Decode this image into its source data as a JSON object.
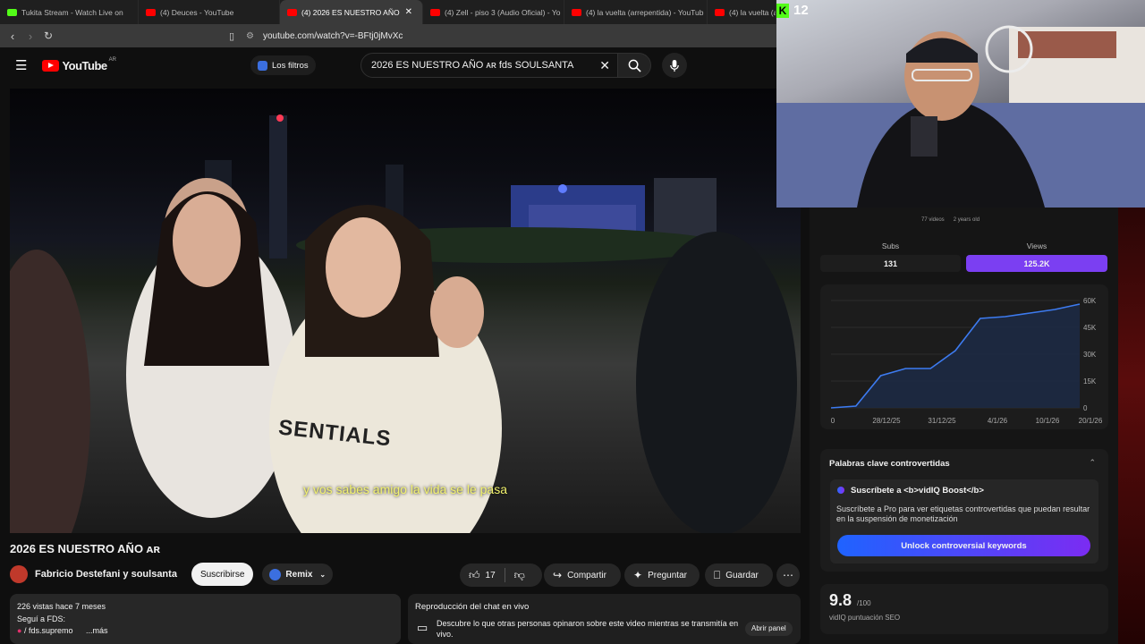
{
  "browser": {
    "tabs": [
      {
        "title": "Tukita Stream - Watch Live on",
        "color": "#53fc18"
      },
      {
        "title": "(4) Deuces - YouTube",
        "color": "#ff0000"
      },
      {
        "title": "(4) 2026 ES NUESTRO AÑO",
        "color": "#ff0000",
        "active": true
      },
      {
        "title": "(4) Zell - piso 3 (Audio Oficial) - Yo",
        "color": "#ff0000"
      },
      {
        "title": "(4) la vuelta (arrepentida) - YouTub",
        "color": "#ff0000"
      },
      {
        "title": "(4) la vuelta (a",
        "color": "#ff0000"
      }
    ],
    "url": "youtube.com/watch?v=-BFtj0jMvXc"
  },
  "youtube": {
    "logo": "YouTube",
    "region": "AR",
    "filters_label": "Los filtros",
    "search_value": "2026 ES NUESTRO AÑO ᴀʀ fds SOULSANTA"
  },
  "video": {
    "caption": "y vos sabes amigo la vida se le pasa",
    "shirt_text": "SENTIALS",
    "title": "2026 ES NUESTRO AÑO ᴀʀ",
    "channel": "Fabricio Destefani y soulsanta",
    "subscribe_label": "Suscribirse",
    "remix_label": "Remix",
    "likes": "17",
    "share_label": "Compartir",
    "ask_label": "Preguntar",
    "save_label": "Guardar"
  },
  "description": {
    "meta": "226 vistas  hace 7 meses",
    "line1": "Seguí a FDS:",
    "handle": "/ fds.supremo",
    "more": "...más"
  },
  "chat_panel": {
    "title": "Reproducción del chat en vivo",
    "text": "Descubre lo que otras personas opinaron sobre este video mientras se transmitía en vivo.",
    "button": "Abrir panel"
  },
  "stream_overlay": {
    "viewers": "12"
  },
  "vidiq": {
    "top_stats": [
      "77 videos",
      "2 years old"
    ],
    "subs_label": "Subs",
    "subs_value": "131",
    "views_label": "Views",
    "views_value": "125.2K",
    "keywords_title": "Palabras clave controvertidas",
    "boost_title": "Suscríbete a <b>vidIQ Boost</b>",
    "boost_text": "Suscríbete a Pro para ver etiquetas controvertidas que puedan resultar en la suspensión de monetización",
    "unlock_label": "Unlock controversial keywords",
    "seo_score": "9.8",
    "seo_max": "/100",
    "seo_label": "vidIQ puntuación SEO"
  },
  "chart_data": {
    "type": "area",
    "x_ticks": [
      "0",
      "28/12/25",
      "31/12/25",
      "4/1/26",
      "10/1/26",
      "20/1/26"
    ],
    "y_ticks": [
      "60K",
      "45K",
      "30K",
      "15K",
      "0"
    ],
    "ylim": [
      0,
      60000
    ],
    "values": [
      0,
      1000,
      18000,
      22000,
      22000,
      32000,
      50000,
      51000,
      53000,
      55000,
      58000
    ],
    "line_color": "#3d7bf0"
  }
}
